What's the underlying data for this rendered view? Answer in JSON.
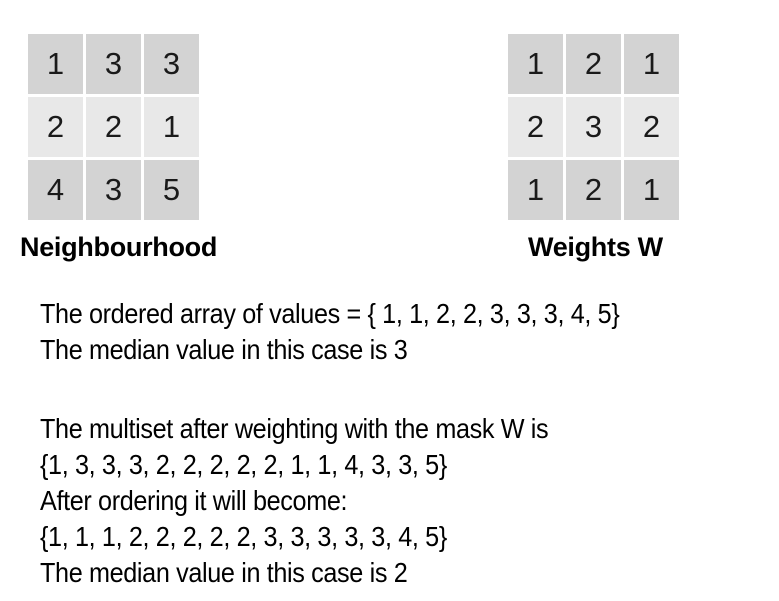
{
  "neighbourhood": {
    "label": "Neighbourhood",
    "rows": [
      [
        "1",
        "3",
        "3"
      ],
      [
        "2",
        "2",
        "1"
      ],
      [
        "4",
        "3",
        "5"
      ]
    ]
  },
  "weights": {
    "label": "Weights W",
    "rows": [
      [
        "1",
        "2",
        "1"
      ],
      [
        "2",
        "3",
        "2"
      ],
      [
        "1",
        "2",
        "1"
      ]
    ]
  },
  "text": {
    "block1": [
      "The ordered array of values = { 1, 1, 2, 2, 3, 3, 3, 4, 5}",
      "The median value in this case is 3"
    ],
    "block2": [
      "The multiset after weighting with the mask W is",
      "{1, 3, 3, 3, 2, 2, 2, 2, 2, 1, 1, 4, 3, 3, 5}",
      "After ordering it will become:",
      "{1, 1, 1, 2, 2, 2, 2, 2, 3, 3, 3, 3, 3, 4, 5}",
      "The median value in this case is 2"
    ]
  },
  "colors": {
    "cell_dark": "#d3d3d3",
    "cell_light": "#e8e8e8"
  }
}
